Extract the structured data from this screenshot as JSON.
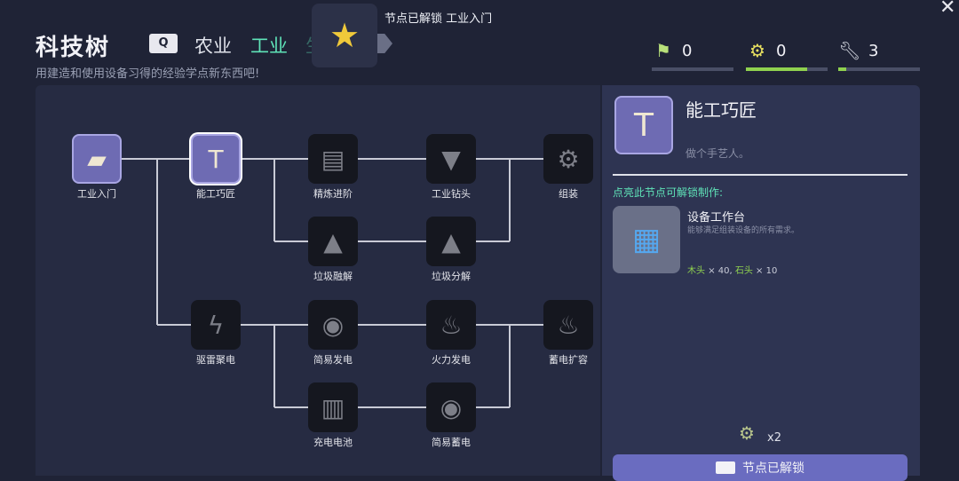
{
  "header": {
    "title": "科技树",
    "subtitle": "用建造和使用设备习得的经验学点新东西吧!",
    "prev_key": "Q",
    "tabs": [
      {
        "label": "农业",
        "active": false
      },
      {
        "label": "工业",
        "active": true
      },
      {
        "label": "生",
        "active": false
      }
    ]
  },
  "toast": {
    "icon": "star-icon",
    "text": "节点已解锁 工业入门"
  },
  "resources": [
    {
      "icon": "leaf-sign-icon",
      "value": "0",
      "progress": 0.0
    },
    {
      "icon": "gear-cog-icon",
      "value": "0",
      "progress": 0.75
    },
    {
      "icon": "wrench-icon",
      "value": "3",
      "progress": 0.1
    }
  ],
  "tree": {
    "nodes": [
      {
        "id": "n1",
        "label": "工业入门",
        "icon": "ingot-icon",
        "glyph": "▰",
        "unlocked": true
      },
      {
        "id": "n2",
        "label": "能工巧匠",
        "icon": "hammer-icon",
        "glyph": "T",
        "unlocked": true,
        "selected": true
      },
      {
        "id": "n3",
        "label": "精炼进阶",
        "icon": "ingots-icon",
        "glyph": "▤",
        "unlocked": false
      },
      {
        "id": "n4",
        "label": "工业钻头",
        "icon": "drill-icon",
        "glyph": "▼",
        "unlocked": false
      },
      {
        "id": "n5",
        "label": "组装",
        "icon": "bolt-nut-icon",
        "glyph": "⚙",
        "unlocked": false
      },
      {
        "id": "n6",
        "label": "垃圾融解",
        "icon": "junk-pile-icon",
        "glyph": "▲",
        "unlocked": false
      },
      {
        "id": "n7",
        "label": "垃圾分解",
        "icon": "junk-pile-icon",
        "glyph": "▲",
        "unlocked": false
      },
      {
        "id": "n8",
        "label": "驱雷聚电",
        "icon": "lightning-icon",
        "glyph": "ϟ",
        "unlocked": false
      },
      {
        "id": "n9",
        "label": "简易发电",
        "icon": "generator-icon",
        "glyph": "◉",
        "unlocked": false
      },
      {
        "id": "n10",
        "label": "火力发电",
        "icon": "fire-bolt-icon",
        "glyph": "♨",
        "unlocked": false
      },
      {
        "id": "n11",
        "label": "蓄电扩容",
        "icon": "fire-bolt-icon",
        "glyph": "♨",
        "unlocked": false
      },
      {
        "id": "n12",
        "label": "充电电池",
        "icon": "battery-icon",
        "glyph": "▥",
        "unlocked": false
      },
      {
        "id": "n13",
        "label": "简易蓄电",
        "icon": "generator-icon",
        "glyph": "◉",
        "unlocked": false
      }
    ]
  },
  "detail": {
    "name": "能工巧匠",
    "description": "做个手艺人。",
    "unlock_heading": "点亮此节点可解锁制作:",
    "recipe": {
      "name": "设备工作台",
      "description": "能够满足组装设备的所有需求。",
      "costs": [
        {
          "material": "木头",
          "amount": "× 40"
        },
        {
          "material": "石头",
          "amount": "× 10"
        }
      ]
    },
    "cost_icon": "gear-cog-icon",
    "cost_amount": "x2",
    "unlock_button": "节点已解锁",
    "colors": {
      "accent": "#5fe3b8",
      "button": "#6a6cc0",
      "unlocked_node": "#6e6bb3"
    }
  },
  "close_label": "✕"
}
